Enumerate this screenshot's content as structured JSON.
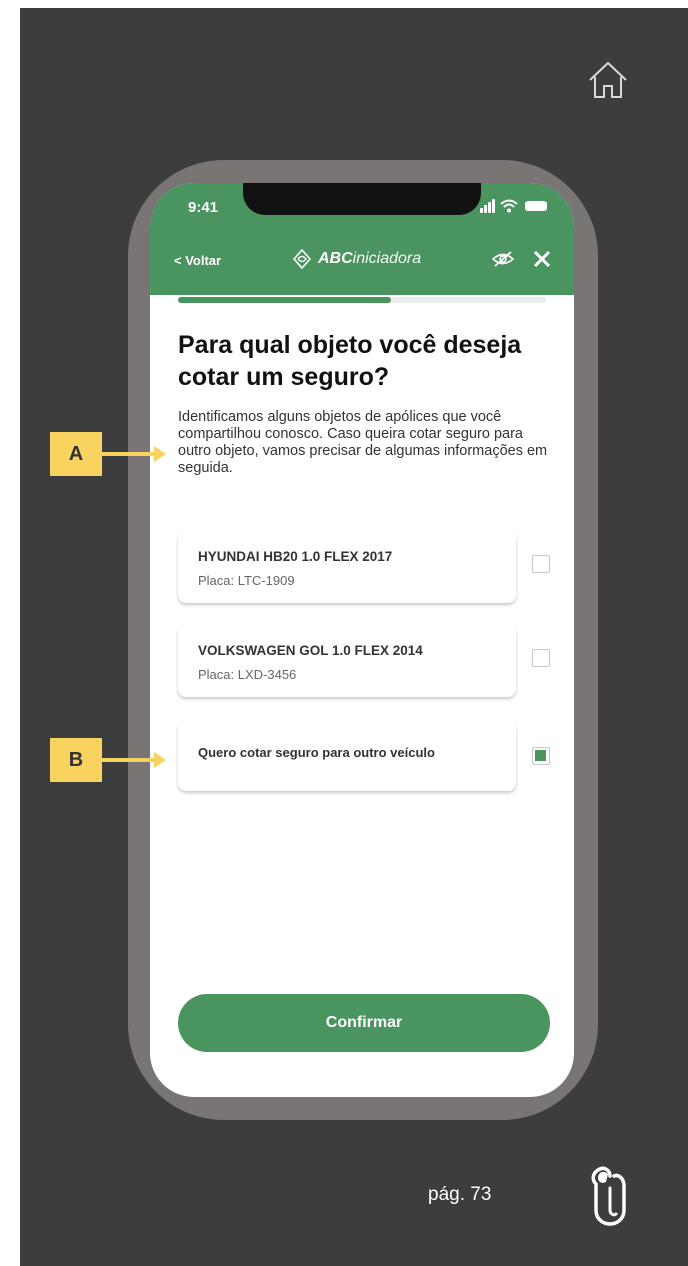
{
  "status_bar": {
    "time": "9:41"
  },
  "header": {
    "back_label": "< Voltar",
    "brand_bold": "ABC",
    "brand_light": "iniciadora"
  },
  "progress": {
    "fraction": 0.58
  },
  "page": {
    "question": "Para qual objeto você deseja cotar um seguro?",
    "description": "Identificamos alguns objetos de apólices que você compartilhou conosco. Caso queira cotar seguro para outro objeto, vamos precisar de algumas informações em seguida."
  },
  "options": [
    {
      "title": "HYUNDAI HB20 1.0 FLEX 2017",
      "subtitle": "Placa: LTC-1909",
      "checked": false
    },
    {
      "title": "VOLKSWAGEN GOL 1.0 FLEX 2014",
      "subtitle": "Placa: LXD-3456",
      "checked": false
    },
    {
      "title": "Quero cotar seguro para outro veículo",
      "subtitle": "",
      "checked": true
    }
  ],
  "confirm_label": "Confirmar",
  "markers": {
    "a": "A",
    "b": "B"
  },
  "footer": {
    "page_number": "pág. 73"
  },
  "colors": {
    "accent": "#4a9460",
    "marker": "#f8d35f",
    "background": "#3d3d3d",
    "frame": "#787574"
  },
  "icons": [
    "home-icon",
    "shield-logo-icon",
    "eye-off-icon",
    "close-icon",
    "paperclip-icon"
  ]
}
